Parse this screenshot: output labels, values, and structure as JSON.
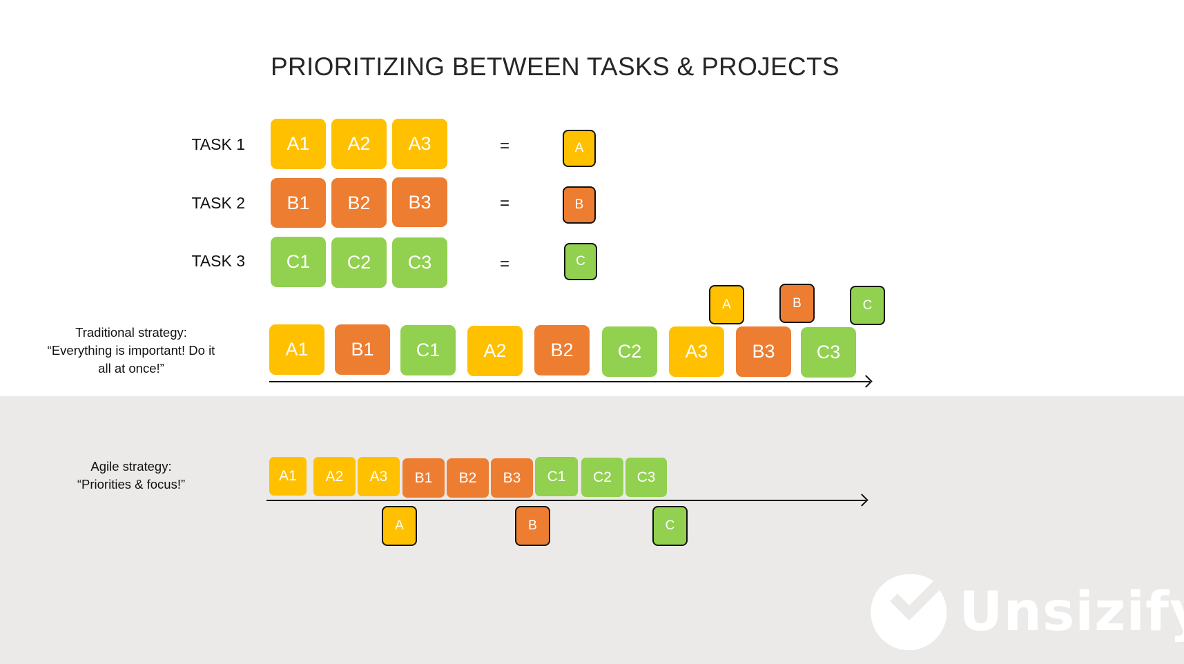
{
  "title": "PRIORITIZING BETWEEN TASKS & PROJECTS",
  "colors": {
    "task_a": "#FFC000",
    "task_b": "#ED7D31",
    "task_c": "#92D050",
    "band": "#EBEAE8"
  },
  "tasks": [
    {
      "label": "TASK 1",
      "subtasks": [
        "A1",
        "A2",
        "A3"
      ],
      "equals": "=",
      "result": "A"
    },
    {
      "label": "TASK 2",
      "subtasks": [
        "B1",
        "B2",
        "B3"
      ],
      "equals": "=",
      "result": "B"
    },
    {
      "label": "TASK 3",
      "subtasks": [
        "C1",
        "C2",
        "C3"
      ],
      "equals": "=",
      "result": "C"
    }
  ],
  "traditional": {
    "caption_line1": "Traditional strategy:",
    "caption_line2": "“Everything is important! Do it",
    "caption_line3": "all at once!”",
    "sequence": [
      "A1",
      "B1",
      "C1",
      "A2",
      "B2",
      "C2",
      "A3",
      "B3",
      "C3"
    ],
    "results": [
      "A",
      "B",
      "C"
    ]
  },
  "agile": {
    "caption_line1": "Agile strategy:",
    "caption_line2": "“Priorities & focus!”",
    "sequence": [
      "A1",
      "A2",
      "A3",
      "B1",
      "B2",
      "B3",
      "C1",
      "C2",
      "C3"
    ],
    "results": [
      "A",
      "B",
      "C"
    ]
  },
  "logo": {
    "text": "Unsizify",
    "icon": "check-circle-icon"
  }
}
